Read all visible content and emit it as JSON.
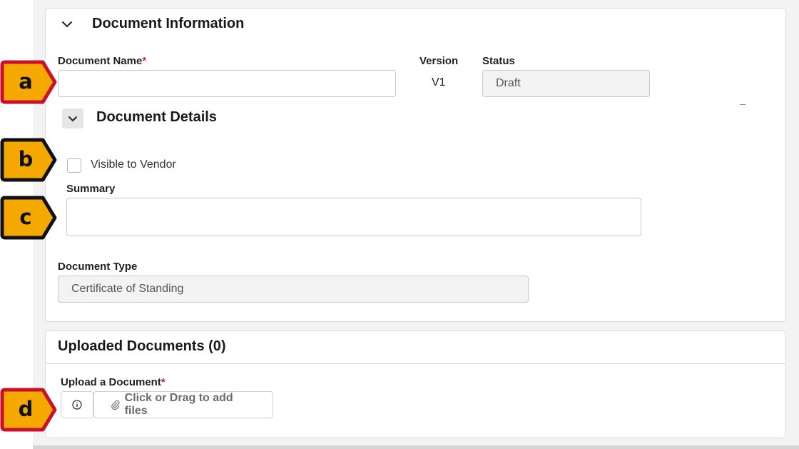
{
  "document_information": {
    "title": "Document Information",
    "document_name_label": "Document Name",
    "required_mark": "*",
    "document_name_value": "",
    "version_label": "Version",
    "version_value": "V1",
    "status_label": "Status",
    "status_value": "Draft"
  },
  "document_details": {
    "title": "Document Details",
    "visible_to_vendor_label": "Visible to Vendor",
    "visible_to_vendor_checked": false,
    "summary_label": "Summary",
    "summary_value": "",
    "document_type_label": "Document Type",
    "document_type_value": "Certificate of Standing"
  },
  "uploaded_documents": {
    "title": "Uploaded Documents (0)",
    "upload_label": "Upload a Document",
    "required_mark": "*",
    "dropzone_label": "Click or Drag to add files"
  },
  "callouts": [
    {
      "letter": "a",
      "border_color": "#c8102e",
      "fill_color": "#f5a800"
    },
    {
      "letter": "b",
      "border_color": "#111111",
      "fill_color": "#f5a800"
    },
    {
      "letter": "c",
      "border_color": "#111111",
      "fill_color": "#f5a800"
    },
    {
      "letter": "d",
      "border_color": "#c8102e",
      "fill_color": "#f5a800"
    }
  ],
  "icons": {
    "collapse_info": "chevron-down-icon",
    "collapse_details": "chevron-down-icon",
    "info": "info-icon",
    "attach": "paperclip-icon"
  }
}
